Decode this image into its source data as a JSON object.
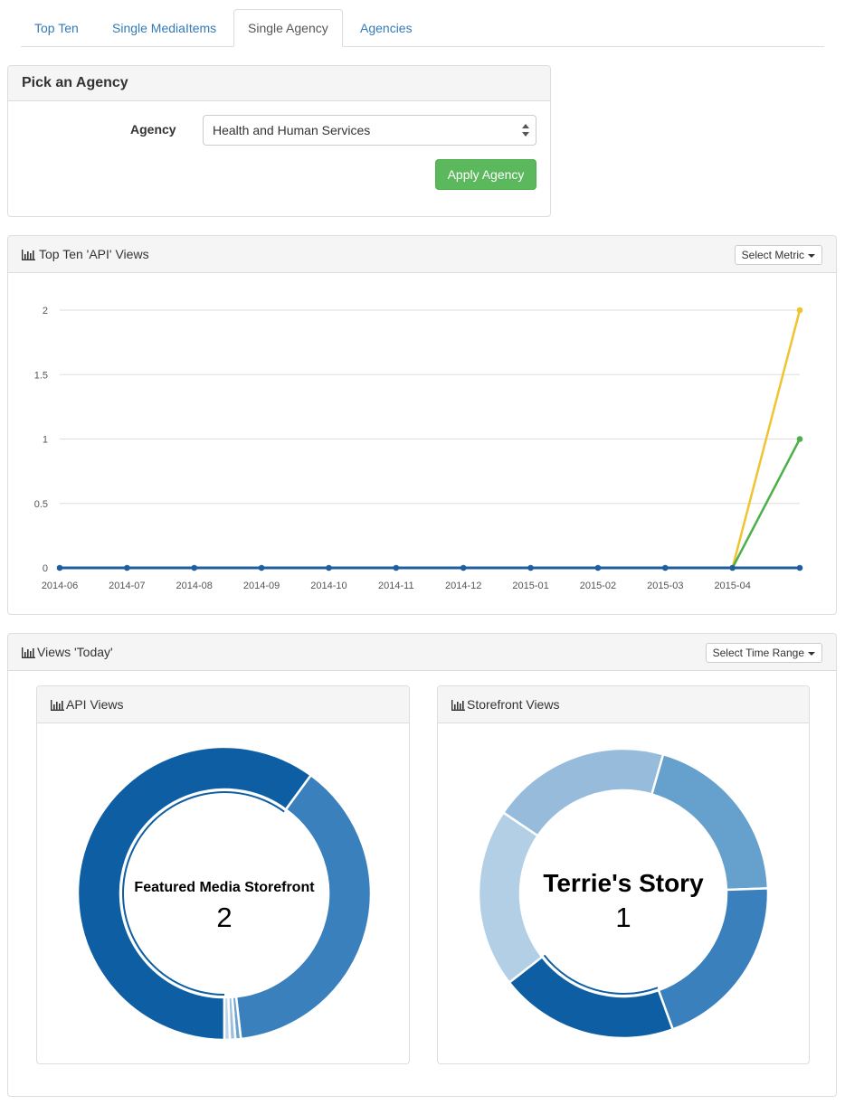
{
  "tabs": [
    {
      "label": "Top Ten",
      "active": false
    },
    {
      "label": "Single MediaItems",
      "active": false
    },
    {
      "label": "Single Agency",
      "active": true
    },
    {
      "label": "Agencies",
      "active": false
    }
  ],
  "agency_panel": {
    "title": "Pick an Agency",
    "agency_label": "Agency",
    "agency_value": "Health and Human Services",
    "apply_label": "Apply Agency"
  },
  "top_ten_panel": {
    "title": "Top Ten 'API' Views",
    "metric_button": "Select Metric"
  },
  "views_panel": {
    "title": "Views 'Today'",
    "time_range_button": "Select Time Range",
    "api_views": {
      "title": "API Views",
      "center_label": "Featured Media Storefront",
      "center_value": "2"
    },
    "storefront_views": {
      "title": "Storefront Views",
      "center_label": "Terrie's Story",
      "center_value": "1"
    }
  },
  "colors": {
    "accent_blue": "#337ab7",
    "success_green": "#5cb85c",
    "series_blue": "#1f5f9e",
    "series_yellow": "#f0c331",
    "series_green": "#4daf4a"
  },
  "chart_data": [
    {
      "type": "line",
      "x_tick_labels": [
        "2014-06",
        "2014-07",
        "2014-08",
        "2014-09",
        "2014-10",
        "2014-11",
        "2014-12",
        "2015-01",
        "2015-02",
        "2015-03",
        "2015-04"
      ],
      "y_tick_labels": [
        "0",
        "0.5",
        "1",
        "1.5",
        "2"
      ],
      "ylim": [
        0,
        2
      ],
      "grid": true,
      "series": [
        {
          "color": "#f0c331",
          "values": [
            0,
            0,
            0,
            0,
            0,
            0,
            0,
            0,
            0,
            0,
            0,
            2
          ]
        },
        {
          "color": "#4daf4a",
          "values": [
            0,
            0,
            0,
            0,
            0,
            0,
            0,
            0,
            0,
            0,
            0,
            1
          ]
        },
        {
          "color": "#1f5f9e",
          "values": [
            0,
            0,
            0,
            0,
            0,
            0,
            0,
            0,
            0,
            0,
            0,
            0
          ]
        }
      ]
    },
    {
      "type": "pie",
      "name": "API Views",
      "slices": [
        {
          "label": "Featured Media Storefront",
          "value": 2,
          "color": "#0e5ea4"
        },
        {
          "value": 1.27,
          "color": "#3a80bc"
        },
        {
          "value": 0.02,
          "color": "#6fa3cf"
        },
        {
          "value": 0.02,
          "color": "#9cc0df"
        },
        {
          "value": 0.02,
          "color": "#bcd5ea"
        }
      ]
    },
    {
      "type": "pie",
      "name": "Storefront Views",
      "slices": [
        {
          "label": "Terrie's Story",
          "value": 1,
          "color": "#0e5ea4"
        },
        {
          "value": 1,
          "color": "#b3cfe6"
        },
        {
          "value": 1,
          "color": "#97bcdb"
        },
        {
          "value": 1,
          "color": "#66a0cc"
        },
        {
          "value": 1,
          "color": "#3a80bc"
        }
      ]
    }
  ]
}
